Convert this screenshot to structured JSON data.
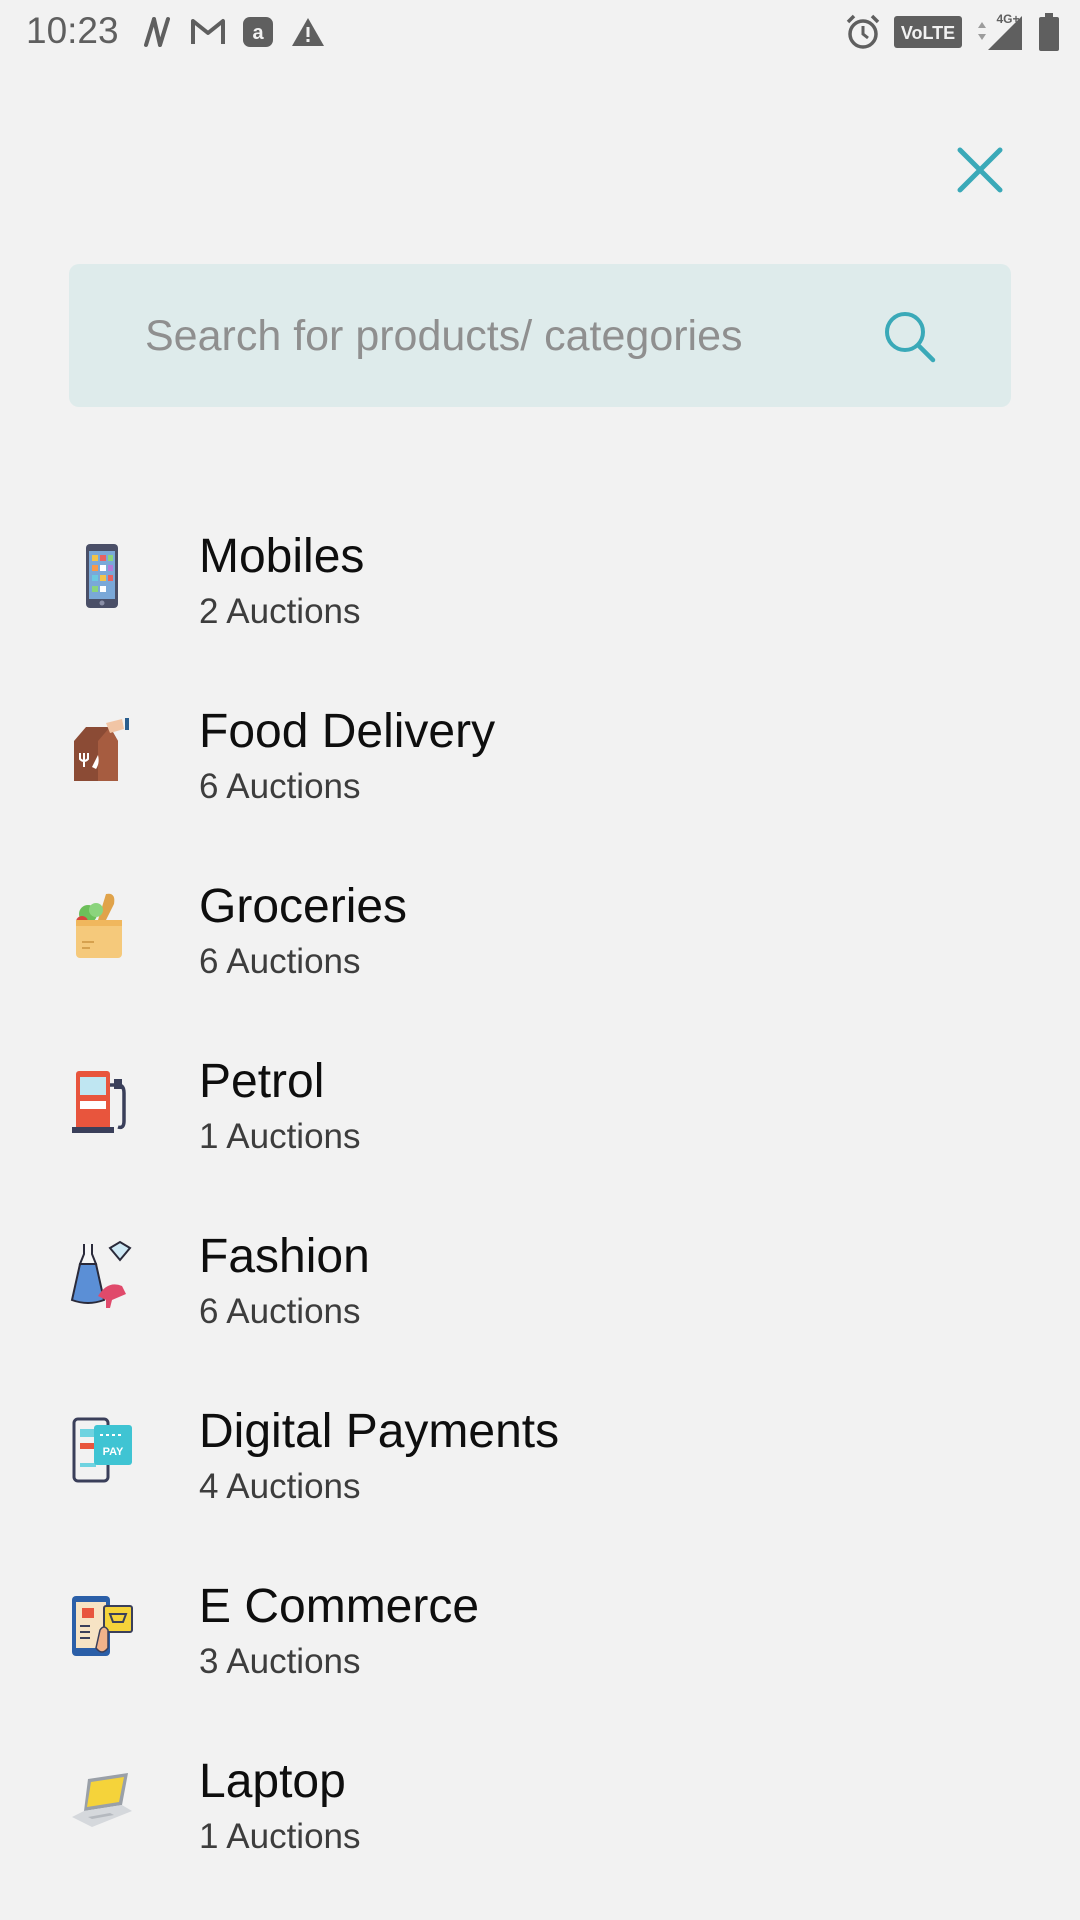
{
  "status_bar": {
    "time": "10:23",
    "left_icons": [
      "n-icon",
      "gmail-icon",
      "amazon-icon",
      "warning-icon"
    ],
    "right_icons": [
      "alarm-icon",
      "volte-icon",
      "signal-4g-icon",
      "battery-icon"
    ],
    "volte_label": "VoLTE",
    "network_label": "4G+"
  },
  "header": {
    "close_icon": "close-icon"
  },
  "search": {
    "placeholder": "Search for products/ categories",
    "value": "",
    "icon": "search-icon"
  },
  "colors": {
    "accent": "#3aa9b8",
    "search_bg": "#deebeb",
    "background": "#f2f2f2"
  },
  "categories": [
    {
      "name": "Mobiles",
      "count": "2 Auctions",
      "icon": "mobile-phone-icon"
    },
    {
      "name": "Food Delivery",
      "count": "6 Auctions",
      "icon": "food-bag-icon"
    },
    {
      "name": "Groceries",
      "count": "6 Auctions",
      "icon": "grocery-bag-icon"
    },
    {
      "name": "Petrol",
      "count": "1 Auctions",
      "icon": "fuel-pump-icon"
    },
    {
      "name": "Fashion",
      "count": "6 Auctions",
      "icon": "dress-heel-icon"
    },
    {
      "name": "Digital Payments",
      "count": "4 Auctions",
      "icon": "phone-pay-icon"
    },
    {
      "name": "E Commerce",
      "count": "3 Auctions",
      "icon": "ecommerce-cart-icon"
    },
    {
      "name": "Laptop",
      "count": "1 Auctions",
      "icon": "laptop-icon"
    }
  ]
}
